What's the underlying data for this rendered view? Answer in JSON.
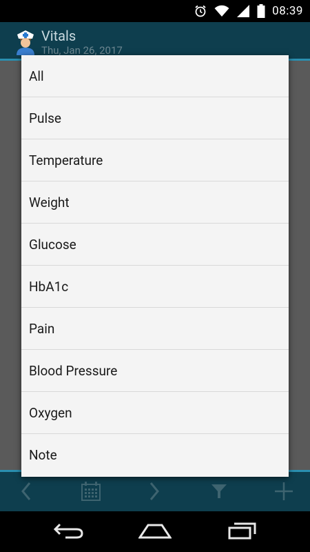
{
  "status_bar": {
    "time": "08:39",
    "icons": [
      "alarm-icon",
      "wifi-icon",
      "signal-icon",
      "battery-icon"
    ]
  },
  "app_bar": {
    "title": "Vitals",
    "subtitle": "Thu, Jan 26, 2017",
    "icon": "nurse-avatar-icon"
  },
  "filter_dialog": {
    "options": [
      "All",
      "Pulse",
      "Temperature",
      "Weight",
      "Glucose",
      "HbA1c",
      "Pain",
      "Blood Pressure",
      "Oxygen",
      "Note"
    ]
  },
  "toolbar": {
    "buttons": [
      "chevron-left-icon",
      "calendar-icon",
      "chevron-right-icon",
      "filter-icon",
      "plus-icon"
    ]
  },
  "nav_bar": {
    "buttons": [
      "back-icon",
      "home-icon",
      "recents-icon"
    ]
  },
  "colors": {
    "app_bar": "#0e3e4e",
    "accent_line": "#2a8fb0",
    "dialog_bg": "#f4f4f4"
  }
}
